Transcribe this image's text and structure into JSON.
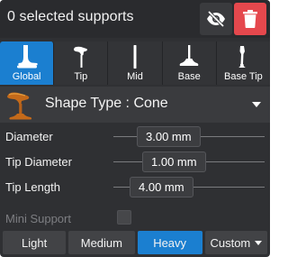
{
  "header": {
    "selection_text": "0 selected supports",
    "hide_icon": "eye-slash-icon",
    "delete_icon": "trash-icon",
    "delete_color": "#e5484d"
  },
  "tabs": [
    {
      "label": "Global",
      "icon": "support-global-icon",
      "active": true
    },
    {
      "label": "Tip",
      "icon": "support-tip-icon",
      "active": false
    },
    {
      "label": "Mid",
      "icon": "support-mid-icon",
      "active": false
    },
    {
      "label": "Base",
      "icon": "support-base-icon",
      "active": false
    },
    {
      "label": "Base Tip",
      "icon": "support-base-tip-icon",
      "active": false
    }
  ],
  "shape": {
    "label": "Shape Type : Cone",
    "icon": "cone-support-icon"
  },
  "params": {
    "diameter": {
      "label": "Diameter",
      "value": "3.00 mm"
    },
    "tip_diameter": {
      "label": "Tip Diameter",
      "value": "1.00 mm"
    },
    "tip_length": {
      "label": "Tip Length",
      "value": "4.00 mm"
    }
  },
  "mini_support": {
    "label": "Mini Support",
    "checked": false
  },
  "presets": [
    {
      "label": "Light",
      "active": false
    },
    {
      "label": "Medium",
      "active": false
    },
    {
      "label": "Heavy",
      "active": true
    },
    {
      "label": "Custom",
      "active": false
    }
  ],
  "accent": "#1b7fd0"
}
